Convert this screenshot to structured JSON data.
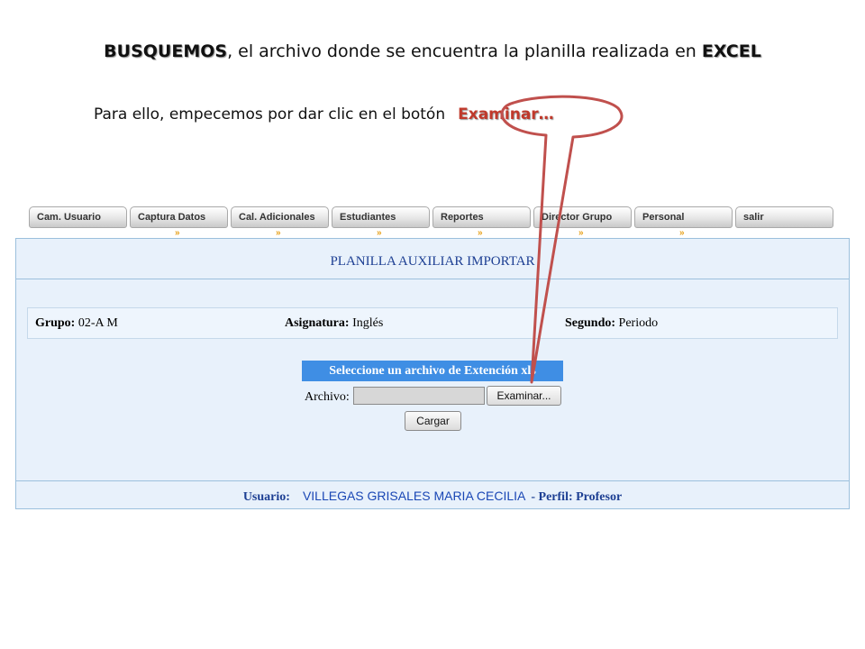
{
  "heading": {
    "prefix": "BUSQUEMOS",
    "middle": ", el archivo donde se encuentra la planilla realizada en ",
    "suffix": "EXCEL"
  },
  "instruction": {
    "text": "Para ello, empecemos por dar clic en el botón",
    "highlight": "Examinar…"
  },
  "nav": {
    "tabs": [
      "Cam. Usuario",
      "Captura Datos",
      "Cal. Adicionales",
      "Estudiantes",
      "Reportes",
      "Director Grupo",
      "Personal",
      "salir"
    ],
    "arrow": "»"
  },
  "panel": {
    "title": "PLANILLA AUXILIAR IMPORTAR",
    "grupo_label": "Grupo:",
    "grupo_value": "02-A M",
    "asignatura_label": "Asignatura:",
    "asignatura_value": "Inglés",
    "periodo_label": "Segundo:",
    "periodo_value": "Periodo",
    "select_file": "Seleccione un archivo de Extención xls",
    "file_label": "Archivo:",
    "browse_button": "Examinar...",
    "load_button": "Cargar"
  },
  "footer": {
    "user_label": "Usuario:",
    "user_name": "VILLEGAS GRISALES MARIA CECILIA",
    "profile": "- Perfil: Profesor"
  },
  "colors": {
    "accent": "#3f8ee4",
    "callout": "#c0504d",
    "panel_bg": "#e8f1fb",
    "title_blue": "#1d3f93"
  }
}
